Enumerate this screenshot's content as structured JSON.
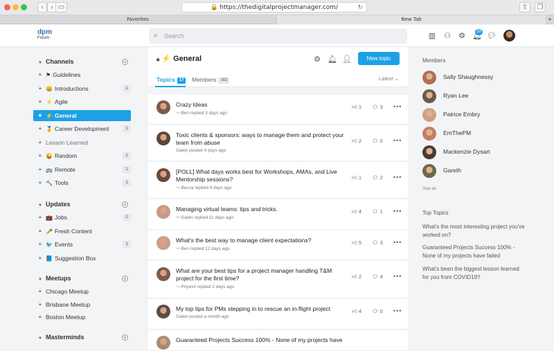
{
  "browser": {
    "url": "https://thedigitalprojectmanager.com/",
    "tabs": [
      "Favorites",
      "New Tab"
    ]
  },
  "brand": {
    "logo": "dpm",
    "sub": "Forum"
  },
  "search": {
    "placeholder": "Search"
  },
  "topbar": {
    "notif_count": "39"
  },
  "sidebar": {
    "channels_title": "Channels",
    "channels": [
      {
        "label": "Guidelines",
        "emoji": "⚑",
        "count": ""
      },
      {
        "label": "Introductions",
        "emoji": "😄",
        "count": "1"
      },
      {
        "label": "Agile",
        "emoji": "⚡",
        "count": ""
      },
      {
        "label": "General",
        "emoji": "⚡",
        "count": "",
        "active": true
      },
      {
        "label": "Career Development",
        "emoji": "🏅",
        "count": "1"
      },
      {
        "label": "Lesson Learned",
        "emoji": "",
        "count": ""
      },
      {
        "label": "Random",
        "emoji": "😜",
        "count": "1"
      },
      {
        "label": "Remote",
        "emoji": "🚌",
        "count": "1"
      },
      {
        "label": "Tools",
        "emoji": "🔨",
        "count": "1"
      }
    ],
    "updates_title": "Updates",
    "updates": [
      {
        "label": "Jobs",
        "emoji": "💼",
        "count": "2"
      },
      {
        "label": "Fresh Content",
        "emoji": "🥕",
        "count": ""
      },
      {
        "label": "Events",
        "emoji": "🐦",
        "count": "1"
      },
      {
        "label": "Suggestion Box",
        "emoji": "📘",
        "count": ""
      }
    ],
    "meetups_title": "Meetups",
    "meetups": [
      {
        "label": "Chicago Meetup"
      },
      {
        "label": "Brisbane Meetup"
      },
      {
        "label": "Boston Meetup"
      }
    ],
    "masterminds_title": "Masterminds"
  },
  "channel": {
    "title": "General",
    "new_topic": "New topic",
    "tab_topics": "Topics",
    "topics_count": "17",
    "tab_members": "Members",
    "members_count": "162",
    "sort": "Latest"
  },
  "topics": [
    {
      "title": "Crazy Ideas",
      "meta": "Ben replied 3 days ago",
      "reply": true,
      "likes": "1",
      "comments": "3"
    },
    {
      "title": "Toxic clients & sponsors: ways to manage them and protect your team from abuse",
      "meta": "Galen posted 4 days ago",
      "reply": false,
      "likes": "2",
      "comments": "0"
    },
    {
      "title": "[POLL] What days works best for Workshops, AMAs, and Live Mentorship sessions?",
      "meta": "Becca replied 4 days ago",
      "reply": true,
      "likes": "1",
      "comments": "2"
    },
    {
      "title": "Managing virtual teams: tips and tricks.",
      "meta": "Galen replied 11 days ago",
      "reply": true,
      "likes": "4",
      "comments": "1"
    },
    {
      "title": "What's the best way to manage client expectations?",
      "meta": "Ben replied 12 days ago",
      "reply": true,
      "likes": "5",
      "comments": "3"
    },
    {
      "title": "What are your best tips for a project manager handling T&M project for the first time?",
      "meta": "Priyesh replied 2 days ago",
      "reply": true,
      "likes": "2",
      "comments": "4"
    },
    {
      "title": "My top tips for PMs stepping in to rescue an in-flight project",
      "meta": "Galen posted a month ago",
      "reply": false,
      "likes": "4",
      "comments": "0"
    },
    {
      "title": "Guaranteed Projects Success 100% - None of my projects have",
      "meta": "",
      "reply": false,
      "likes": "",
      "comments": ""
    }
  ],
  "members_panel": {
    "title": "Members",
    "see_all": "See all",
    "members": [
      "Sally Shaughnessy",
      "Ryan Lee",
      "Patrice Embry",
      "EmThePM",
      "Mackenzie Dysart",
      "Gareth"
    ]
  },
  "top_topics": {
    "title": "Top Topics",
    "items": [
      "What's the most interesting project you've worked on?",
      "Guaranteed Projects Success 100% - None of my projects have failed",
      "What's been the biggest lesson learned for you from COVID19?"
    ]
  },
  "colors": {
    "accent": "#1da1e6",
    "brand": "#2c6fb5"
  },
  "icons": [
    "lock-icon",
    "lightning-icon",
    "settings-icon",
    "bell-icon",
    "user-icon",
    "like-icon",
    "comment-icon",
    "more-icon",
    "search-icon"
  ]
}
